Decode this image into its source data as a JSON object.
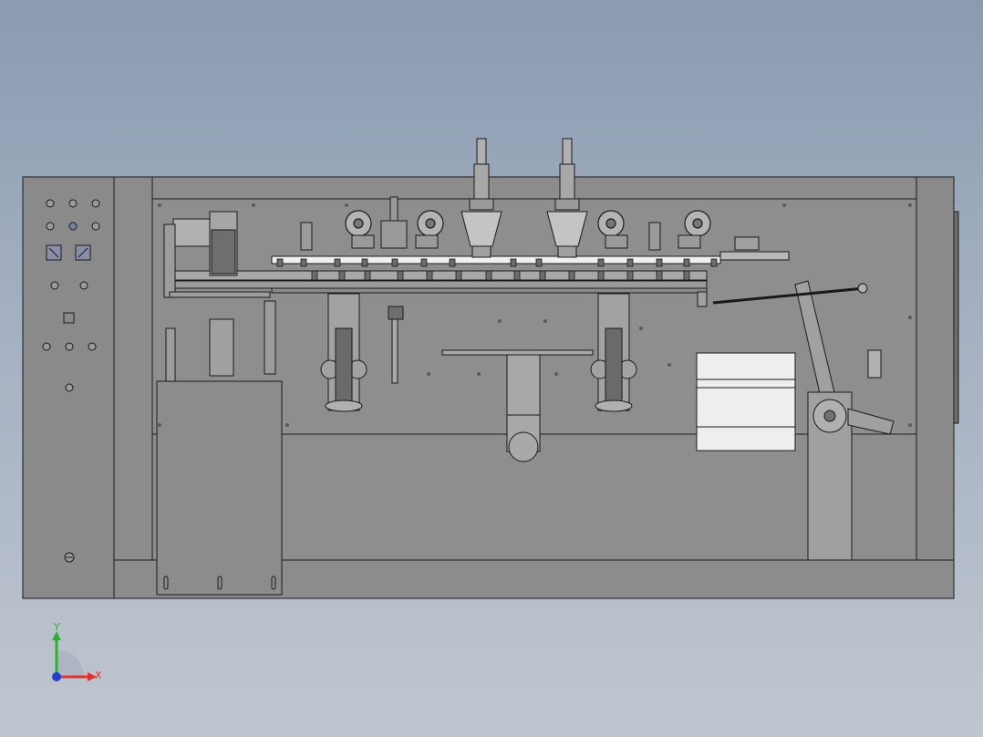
{
  "triad": {
    "x_label": "X",
    "y_label": "Y",
    "colors": {
      "x": "#e03030",
      "y": "#30b030",
      "z": "#2040d0"
    }
  },
  "colors": {
    "background_top": "#8a9bb0",
    "background_bottom": "#c0c6cf",
    "body": "#8c8c8c",
    "line": "#1a1a1a",
    "panel_light": "#e8e8e8"
  }
}
